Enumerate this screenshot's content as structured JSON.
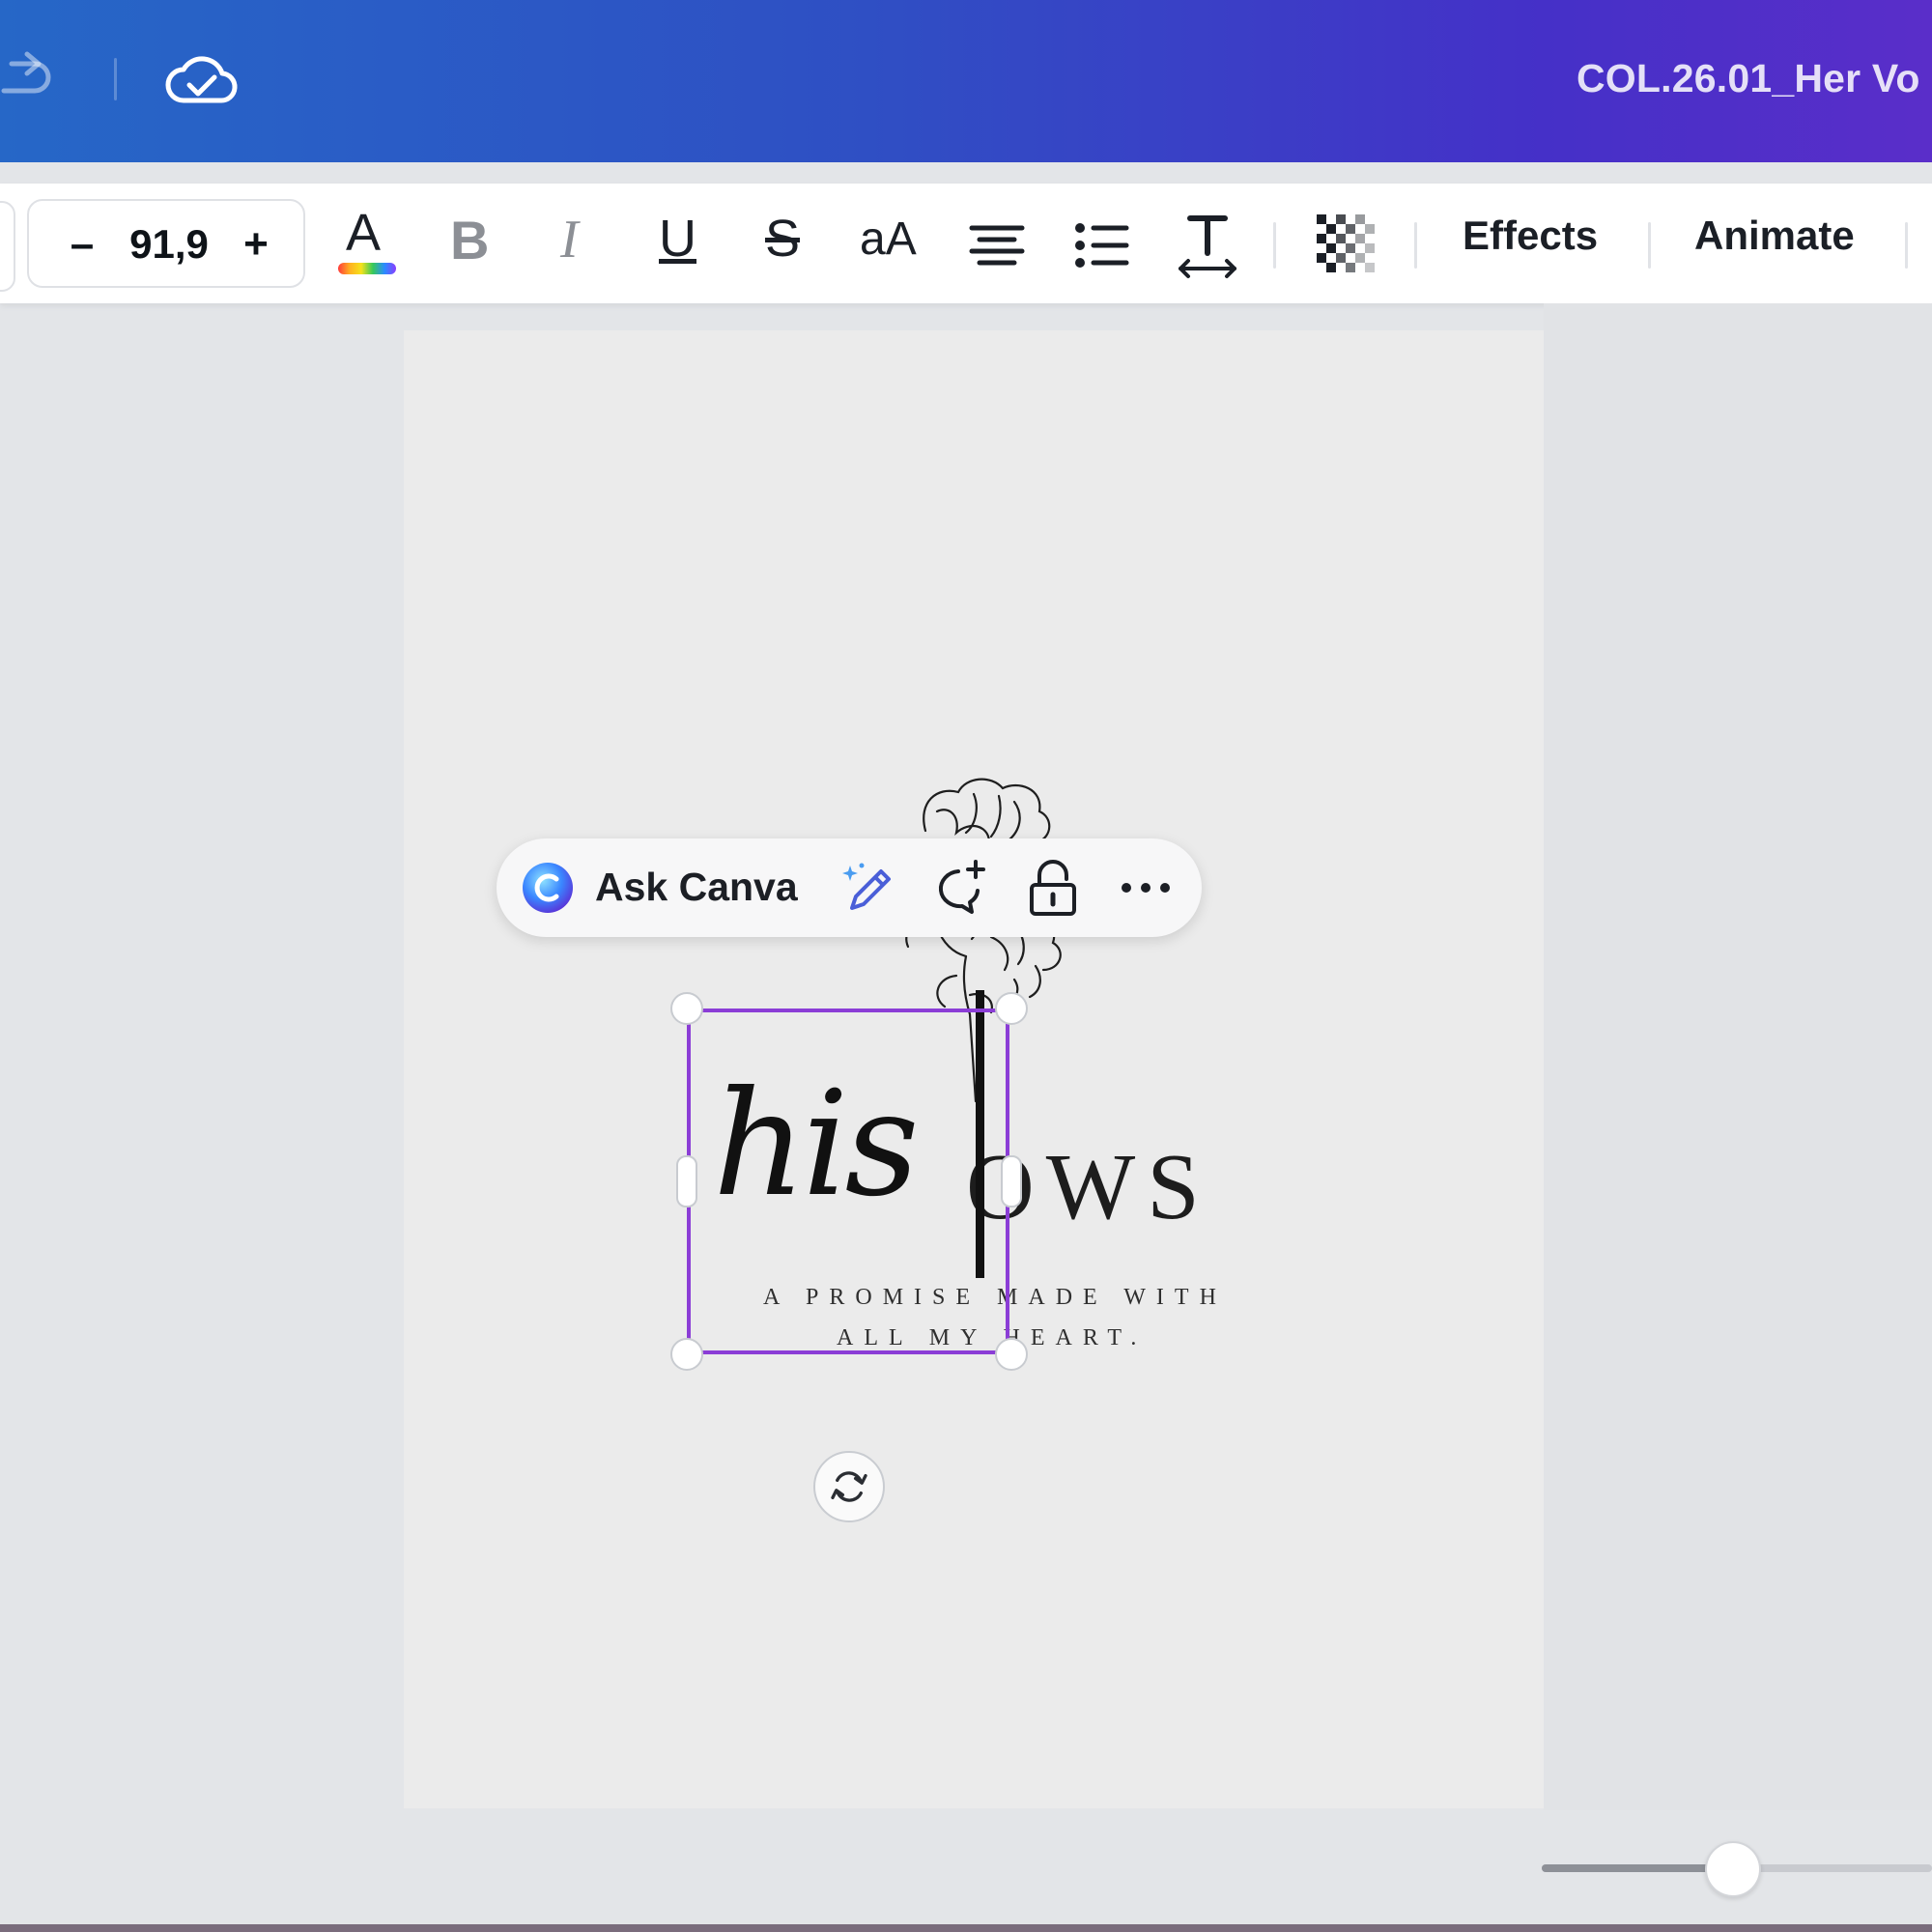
{
  "header": {
    "document_title": "COL.26.01_Her Vo"
  },
  "toolbar": {
    "font_size": "91,9",
    "minus_label": "–",
    "plus_label": "+",
    "text_color_glyph": "A",
    "bold_glyph": "B",
    "italic_glyph": "I",
    "underline_glyph": "U",
    "strikethrough_glyph": "S",
    "case_glyph": "aA",
    "effects_label": "Effects",
    "animate_label": "Animate"
  },
  "floating_toolbar": {
    "ask_label": "Ask Canva"
  },
  "canvas": {
    "script_text": "his",
    "caps_text": "OWS",
    "subtitle_line1": "A PROMISE MADE WITH",
    "subtitle_line2": "ALL MY HEART."
  },
  "zoom": {
    "level_fraction": 0.49
  },
  "colors": {
    "selection": "#8b3dd6",
    "header_gradient_start": "#2667c7",
    "header_gradient_end": "#5a2ec9"
  }
}
